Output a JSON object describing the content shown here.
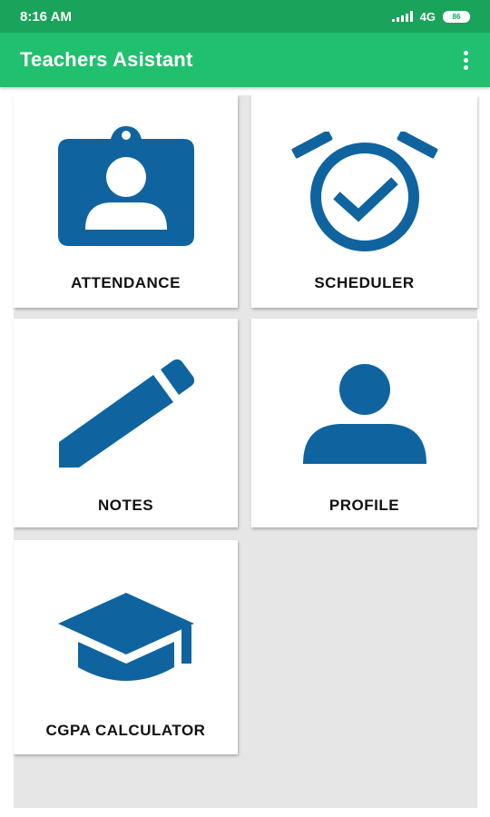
{
  "status_bar": {
    "time": "8:16 AM",
    "network": "4G",
    "battery": "86"
  },
  "app_bar": {
    "title": "Teachers Asistant",
    "menu_icon": "more-vert-icon"
  },
  "theme": {
    "status_bar_color": "#1aa35a",
    "app_bar_color": "#21c06e",
    "icon_color": "#0f649f",
    "background_color": "#e6e6e6"
  },
  "tiles": [
    {
      "label": "ATTENDANCE",
      "icon": "id-badge-icon"
    },
    {
      "label": "SCHEDULER",
      "icon": "alarm-check-icon"
    },
    {
      "label": "NOTES",
      "icon": "pencil-icon"
    },
    {
      "label": "PROFILE",
      "icon": "person-icon"
    },
    {
      "label": "CGPA CALCULATOR",
      "icon": "graduation-cap-icon"
    }
  ]
}
